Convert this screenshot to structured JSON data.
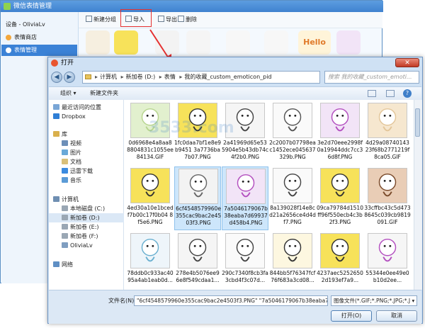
{
  "colors": {
    "accent": "#3b82d6",
    "highlight": "#e53030",
    "selected_tile": "#cde6fb"
  },
  "bg_window": {
    "title": "微信表情管理",
    "sidebar": {
      "account": "设备 - OliviaLv",
      "items": [
        {
          "label": "表情商店",
          "icon": "store-icon"
        },
        {
          "label": "表情管理",
          "icon": "manage-icon"
        }
      ]
    },
    "toolbar": {
      "new_group": "新建分组",
      "import": "导入",
      "export": "导出",
      "delete": "删除"
    },
    "sticker_text": "Hello"
  },
  "dialog": {
    "title": "打开",
    "close_label": "✕",
    "breadcrumb": [
      "计算机",
      "新加卷 (D:)",
      "表情",
      "我的收藏_custom_emoticon_pid"
    ],
    "search_placeholder": "搜索 我的收藏_custom_emoti...",
    "toolbar": {
      "organize": "组织 ▾",
      "new_folder": "新建文件夹"
    },
    "nav": [
      {
        "label": "最近访问的位置",
        "icon": "recent-icon",
        "color": "#7aa6d6"
      },
      {
        "label": "Dropbox",
        "icon": "dropbox-icon",
        "color": "#2f7fd6"
      },
      {
        "label": "库",
        "icon": "library-icon",
        "color": "#d9b04c"
      },
      {
        "label": "视频",
        "icon": "video-icon",
        "color": "#6d8fb8"
      },
      {
        "label": "图片",
        "icon": "picture-icon",
        "color": "#6aa9d8"
      },
      {
        "label": "文档",
        "icon": "document-icon",
        "color": "#d9c07a"
      },
      {
        "label": "迅雷下载",
        "icon": "download-icon",
        "color": "#3b8be0"
      },
      {
        "label": "音乐",
        "icon": "music-icon",
        "color": "#5b9bd6"
      },
      {
        "label": "计算机",
        "icon": "computer-icon",
        "color": "#6f8fb2"
      },
      {
        "label": "本地磁盘 (C:)",
        "icon": "drive-icon",
        "color": "#9aa7b4"
      },
      {
        "label": "新加卷 (D:)",
        "icon": "drive-icon",
        "color": "#9aa7b4"
      },
      {
        "label": "新加卷 (E:)",
        "icon": "drive-icon",
        "color": "#9aa7b4"
      },
      {
        "label": "新加卷 (F:)",
        "icon": "drive-icon",
        "color": "#9aa7b4"
      },
      {
        "label": "OliviaLv",
        "icon": "user-icon",
        "color": "#7f9ec0"
      },
      {
        "label": "网络",
        "icon": "network-icon",
        "color": "#5f8fc4"
      }
    ],
    "files": [
      {
        "name": "0d6968e4a8aa88804831c1055ee84134.GIF",
        "bg": "#e2f0ce",
        "fg": "#b7d58f"
      },
      {
        "name": "1fc0daa7bf1e8e9b9451 3a7736ba7b07.PNG",
        "bg": "#f7e25a",
        "fg": "#333"
      },
      {
        "name": "2a41969d65e535904e5b43db74c4f2b0.PNG",
        "bg": "#f5f5f5",
        "fg": "#444"
      },
      {
        "name": "2c2007b07798eac1452ece045637329b.PNG",
        "bg": "#fafafa",
        "fg": "#555"
      },
      {
        "name": "3e2d70eee2998f0a19944ddc7cc36d8f.PNG",
        "bg": "#f2e4f7",
        "fg": "#b34fbf"
      },
      {
        "name": "4d29a0874014323f68b2771219f8ca05.GIF",
        "bg": "#f6e7cf",
        "fg": "#e3c69a"
      },
      {
        "name": "4ed30a10e1bcedf7b00c17f0b04 8f5e6.PNG",
        "bg": "#f7e25a",
        "fg": "#333"
      },
      {
        "name": "6cf4548579960e355cac9bac2e4503f3.PNG",
        "bg": "#f3f3f3",
        "fg": "#666"
      },
      {
        "name": "7a5046179067b38eaba7d69937d458b4.PNG",
        "bg": "#f2e4f7",
        "fg": "#b34fbf"
      },
      {
        "name": "8a139028f14e8cd21a2656ce4d4df7.PNG",
        "bg": "#fafafa",
        "fg": "#444"
      },
      {
        "name": "09ca79784d1510ff96f550ecb4c3b2f3.PNG",
        "bg": "#f7e25a",
        "fg": "#333"
      },
      {
        "name": "33cffbc43c5d4738645c039cb9819091.GIF",
        "bg": "#e9cdb6",
        "fg": "#7a4a2a"
      },
      {
        "name": "78ddb0c933ac4095a4ab1eab0d...",
        "bg": "#eef5fa",
        "fg": "#6ab0d0"
      },
      {
        "name": "278e4b5076ee9 6e8f549cdaa1...",
        "bg": "#f5f5f5",
        "fg": "#444"
      },
      {
        "name": "290c7340f8cb3fa3cbd4f3c07d...",
        "bg": "#fafafa",
        "fg": "#444"
      },
      {
        "name": "844bb5f76347fcf76f683a3cd08...",
        "bg": "#fdf7e0",
        "fg": "#333"
      },
      {
        "name": "4237aec52526502d193ef7a9...",
        "bg": "#f7e25a",
        "fg": "#333"
      },
      {
        "name": "55344e0ee49e0b10d2ee...",
        "bg": "#f6f6f6",
        "fg": "#b34fbf"
      }
    ],
    "filename_label": "文件名(N):",
    "filename_value": "\"6cf4548579960e355cac9bac2e4503f3.PNG\" \"7a5046179067b38eaba7d699",
    "filetype_value": "图像文件(*.GIF;*.PNG;*.JPG;*.J ▾",
    "open_label": "打开(O)",
    "cancel_label": "取消"
  },
  "watermark": "3533.com"
}
